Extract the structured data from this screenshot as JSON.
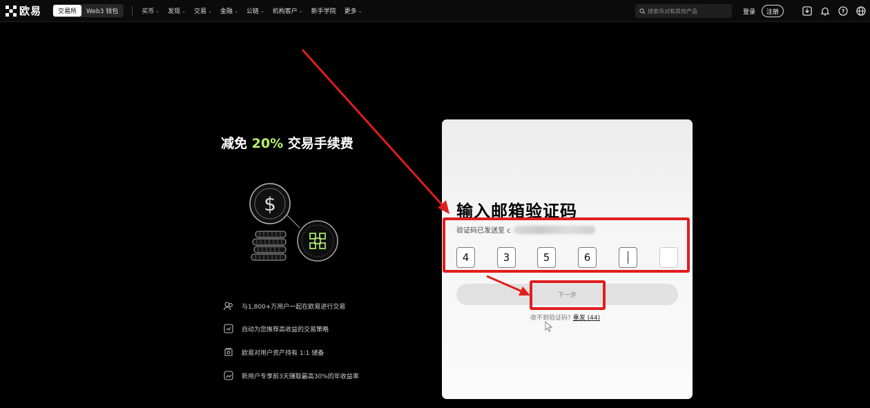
{
  "header": {
    "logo_text": "欧易",
    "segment": [
      "交易所",
      "Web3 钱包"
    ],
    "nav": [
      "买币",
      "发现",
      "交易",
      "金融",
      "公链",
      "机构客户",
      "新手学院",
      "更多"
    ],
    "nav_has_chevron": [
      true,
      true,
      true,
      true,
      true,
      true,
      false,
      true
    ],
    "search_placeholder": "搜索币对和其他产品",
    "login": "登录",
    "register": "注册",
    "icons": [
      "download-icon",
      "bell-icon",
      "help-icon",
      "globe-icon"
    ]
  },
  "promo": {
    "title_prefix": "减免 ",
    "title_highlight": "20%",
    "title_suffix": " 交易手续费",
    "highlight_color": "#b7f26b",
    "features": [
      {
        "icon": "users-icon",
        "text": "与1,800+万用户一起在欧易进行交易"
      },
      {
        "icon": "strategy-icon",
        "text": "自动为您推荐高收益的交易策略"
      },
      {
        "icon": "reserve-icon",
        "text": "欧易对用户资产持有 1:1 储备"
      },
      {
        "icon": "earn-icon",
        "text": "新用户专享前3天赚取最高30%的年收益率"
      }
    ]
  },
  "verify": {
    "title": "输入邮箱验证码",
    "sent_text": "验证码已发送至 c",
    "digits": [
      "4",
      "3",
      "5",
      "6",
      "",
      ""
    ],
    "next_label": "下一步",
    "no_code_text": "收不到验证码?",
    "resend_label": "重发 (44)"
  },
  "colors": {
    "annotation_red": "#e11d1d",
    "accent_green": "#b7f26b"
  }
}
